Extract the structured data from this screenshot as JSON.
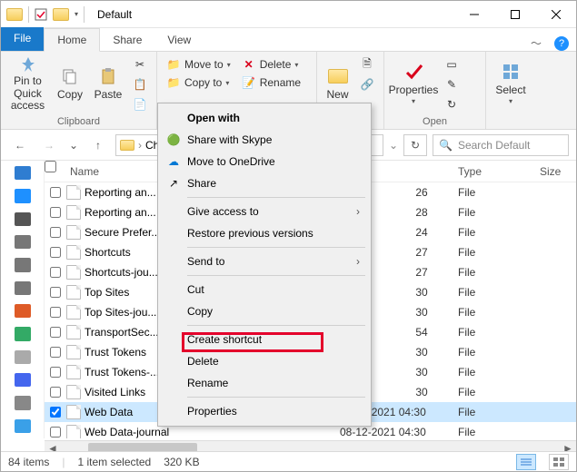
{
  "window": {
    "title": "Default"
  },
  "tabs": {
    "file": "File",
    "home": "Home",
    "share": "Share",
    "view": "View"
  },
  "ribbon": {
    "clipboard": {
      "label": "Clipboard",
      "pin": "Pin to Quick access",
      "copy": "Copy",
      "paste": "Paste"
    },
    "organize": {
      "move": "Move to",
      "copy": "Copy to",
      "delete": "Delete",
      "rename": "Rename"
    },
    "new": {
      "label": "New"
    },
    "open": {
      "label": "Open",
      "properties": "Properties"
    },
    "select": {
      "label": "Select"
    }
  },
  "nav": {
    "crumb1": "Chr",
    "search_placeholder": "Search Default"
  },
  "columns": {
    "name": "Name",
    "type": "Type",
    "size": "Size"
  },
  "files": [
    {
      "name": "Reporting an...",
      "date": "",
      "date_suffix": "26",
      "type": "File"
    },
    {
      "name": "Reporting an...",
      "date": "",
      "date_suffix": "28",
      "type": "File"
    },
    {
      "name": "Secure Prefer...",
      "date": "",
      "date_suffix": "24",
      "type": "File"
    },
    {
      "name": "Shortcuts",
      "date": "",
      "date_suffix": "27",
      "type": "File"
    },
    {
      "name": "Shortcuts-jou...",
      "date": "",
      "date_suffix": "27",
      "type": "File"
    },
    {
      "name": "Top Sites",
      "date": "",
      "date_suffix": "30",
      "type": "File"
    },
    {
      "name": "Top Sites-jou...",
      "date": "",
      "date_suffix": "30",
      "type": "File"
    },
    {
      "name": "TransportSec...",
      "date": "",
      "date_suffix": "54",
      "type": "File"
    },
    {
      "name": "Trust Tokens",
      "date": "",
      "date_suffix": "30",
      "type": "File"
    },
    {
      "name": "Trust Tokens-...",
      "date": "",
      "date_suffix": "30",
      "type": "File"
    },
    {
      "name": "Visited Links",
      "date": "",
      "date_suffix": "30",
      "type": "File"
    },
    {
      "name": "Web Data",
      "date": "08-12-2021 04:30",
      "date_suffix": "",
      "type": "File",
      "selected": true
    },
    {
      "name": "Web Data-journal",
      "date": "08-12-2021 04:30",
      "date_suffix": "",
      "type": "File"
    }
  ],
  "context_menu": {
    "open_with": "Open with",
    "skype": "Share with Skype",
    "onedrive": "Move to OneDrive",
    "share": "Share",
    "give_access": "Give access to",
    "restore": "Restore previous versions",
    "send_to": "Send to",
    "cut": "Cut",
    "copy": "Copy",
    "shortcut": "Create shortcut",
    "delete": "Delete",
    "rename": "Rename",
    "properties": "Properties"
  },
  "status": {
    "count": "84 items",
    "selection": "1 item selected",
    "size": "320 KB"
  }
}
